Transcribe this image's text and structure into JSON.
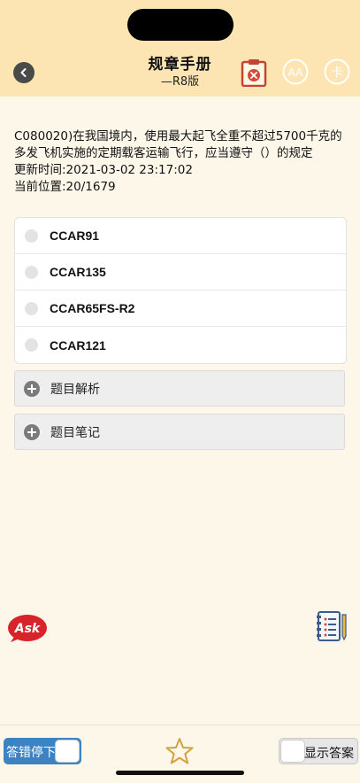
{
  "header": {
    "title": "规章手册",
    "subtitle": "—R8版",
    "back_icon": "chevron-left-icon",
    "clipboard_icon": "clipboard-x-icon",
    "font_icon": "font-size-icon",
    "card_icon": "card-icon",
    "font_icon_text": "AA",
    "card_icon_text": "卡",
    "colors": {
      "bar": "#fde5b3",
      "clipboard": "#d44a3a",
      "icon_outline": "#ffffff"
    }
  },
  "question": {
    "text": "C080020)在我国境内，使用最大起飞全重不超过5700千克的多发飞机实施的定期载客运输飞行，应当遵守（）的规定",
    "updated": "更新时间:2021-03-02 23:17:02",
    "position": "当前位置:20/1679"
  },
  "options": [
    {
      "label": "CCAR91"
    },
    {
      "label": "CCAR135"
    },
    {
      "label": "CCAR65FS-R2"
    },
    {
      "label": "CCAR121"
    }
  ],
  "panels": {
    "analysis": "题目解析",
    "notes": "题目笔记"
  },
  "floating": {
    "ask_label": "Ask",
    "ask_icon": "ask-logo-icon",
    "notes_icon": "notebook-icon"
  },
  "bottom": {
    "stop_on_error": "答错停下",
    "show_answer": "显示答案",
    "favorite_icon": "star-icon",
    "accent": "#3c83c3"
  }
}
